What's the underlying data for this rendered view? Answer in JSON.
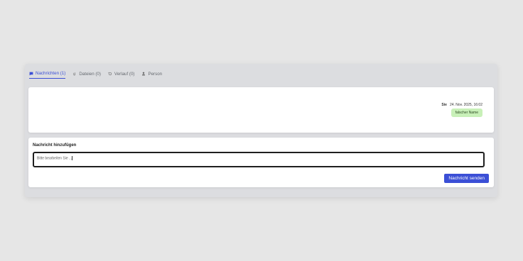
{
  "tabs": [
    {
      "label": "Nachrichten (1)",
      "icon": "message-icon",
      "active": true
    },
    {
      "label": "Dateien (0)",
      "icon": "paperclip-icon",
      "active": false
    },
    {
      "label": "Verlauf (0)",
      "icon": "history-icon",
      "active": false
    },
    {
      "label": "Person",
      "icon": "person-icon",
      "active": false
    }
  ],
  "message": {
    "sender": "Sie",
    "timestamp": "24. Nov. 2025, 16:02",
    "tag": "falscher Name"
  },
  "compose": {
    "title": "Nachricht hinzufügen",
    "value": "Bitte bearbeiten Sie ...",
    "send_label": "Nachricht senden"
  },
  "colors": {
    "accent": "#3b4fd6",
    "tag_bg": "#c8f0b8"
  }
}
